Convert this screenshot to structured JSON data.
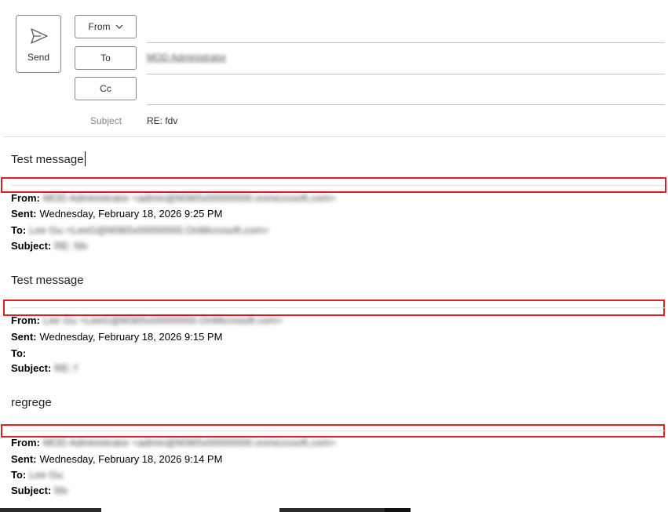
{
  "compose": {
    "send_label": "Send",
    "from_label": "From",
    "to_label": "To",
    "cc_label": "Cc",
    "subject_label": "Subject",
    "subject_value": "RE: fdv",
    "to_recipient": "MOD Administrator"
  },
  "body": {
    "current_message": "Test message"
  },
  "quotes": [
    {
      "from_label": "From:",
      "from_value": "MOD Administrator <admin@M365x00000000.onmicrosoft.com>",
      "sent_label": "Sent:",
      "sent_value": "Wednesday, February 18, 2026 9:25 PM",
      "to_label": "To:",
      "to_value": "Lee Gu <LeeG@M365x00000000.OnMicrosoft.com>",
      "subject_label": "Subject:",
      "subject_value": "RE: fdv",
      "message": "Test  message"
    },
    {
      "from_label": "From:",
      "from_value": "Lee Gu <LeeG@M365x00000000.OnMicrosoft.com>",
      "sent_label": "Sent:",
      "sent_value": "Wednesday, February 18, 2026 9:15 PM",
      "to_label": "To:",
      "to_value": "",
      "subject_label": "Subject:",
      "subject_value": "RE: f",
      "message": "regrege"
    },
    {
      "from_label": "From:",
      "from_value": "MOD Administrator <admin@M365x00000000.onmicrosoft.com>",
      "sent_label": "Sent:",
      "sent_value": "Wednesday, February 18, 2026 9:14 PM",
      "to_label": "To:",
      "to_value": "Lee Gu",
      "subject_label": "Subject:",
      "subject_value": "fdv"
    }
  ],
  "colors": {
    "highlight": "#e02020",
    "border": "#8a8886",
    "muted_text": "#8a8886"
  },
  "icons": {
    "send": "send-icon",
    "dropdown": "chevron-down-icon"
  }
}
